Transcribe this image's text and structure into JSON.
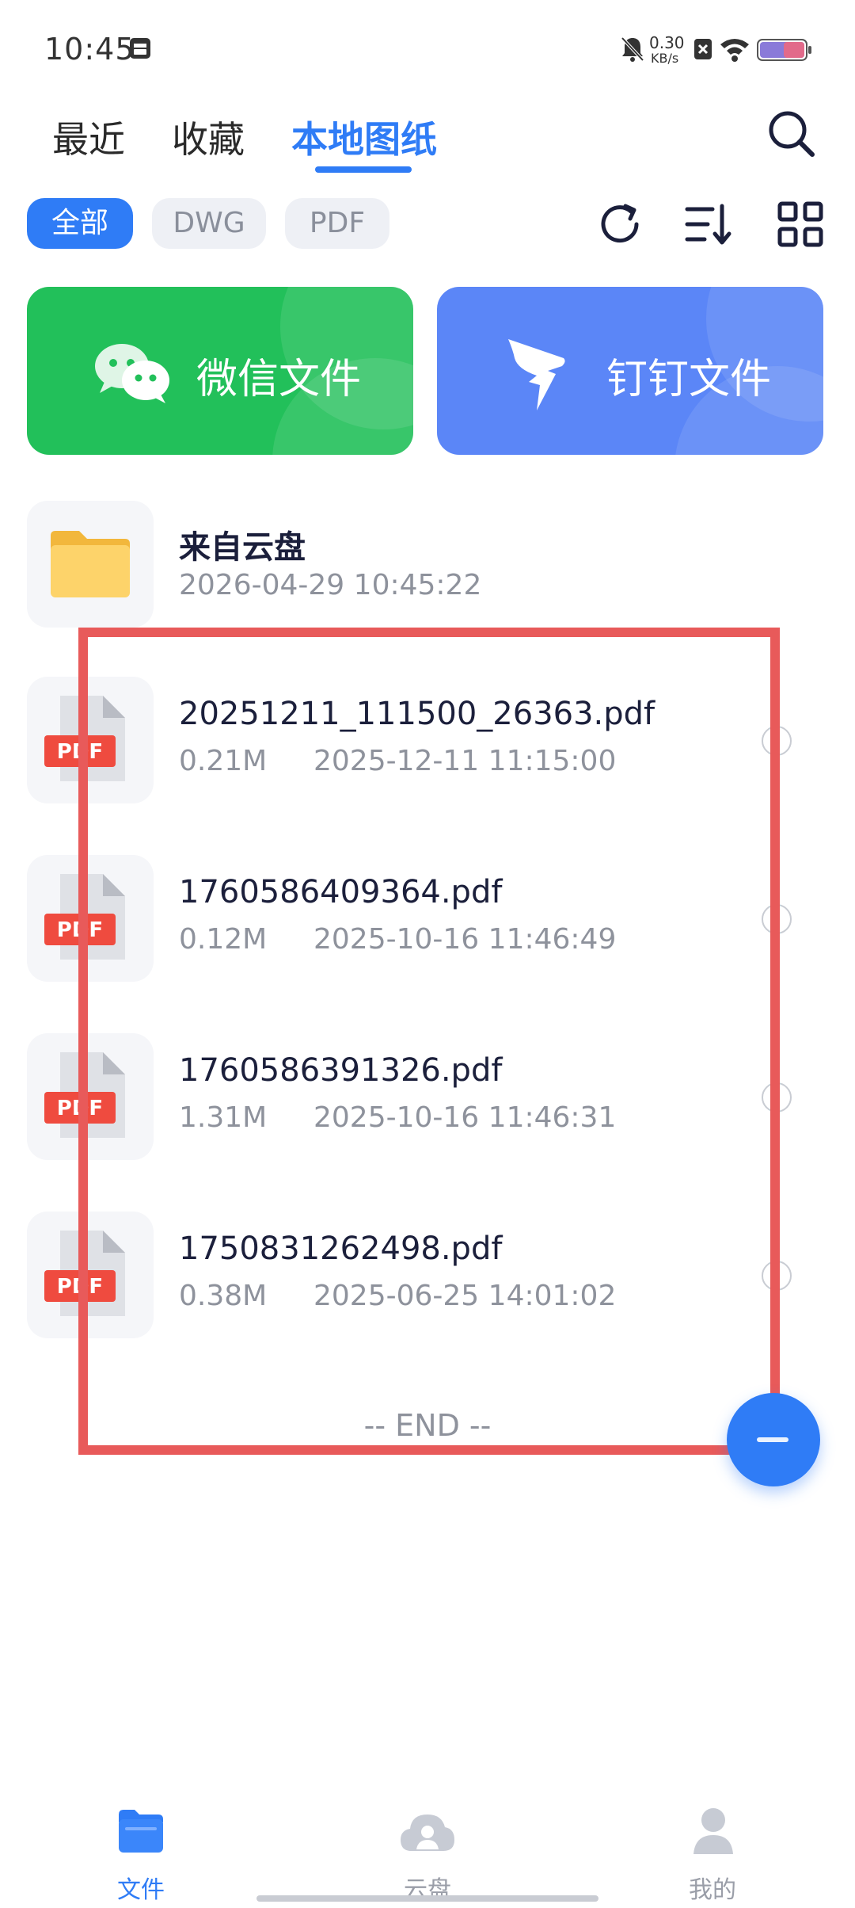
{
  "status_bar": {
    "time": "10:45",
    "net_speed_value": "0.30",
    "net_speed_unit": "KB/s"
  },
  "tabs": [
    {
      "label": "最近",
      "active": false
    },
    {
      "label": "收藏",
      "active": false
    },
    {
      "label": "本地图纸",
      "active": true
    }
  ],
  "filters": [
    {
      "label": "全部",
      "active": true
    },
    {
      "label": "DWG",
      "active": false
    },
    {
      "label": "PDF",
      "active": false
    }
  ],
  "cards": [
    {
      "label": "微信文件",
      "icon": "wechat-icon",
      "color": "#22c05a"
    },
    {
      "label": "钉钉文件",
      "icon": "dingtalk-icon",
      "color": "#5b86f7"
    }
  ],
  "folder": {
    "name": "来自云盘",
    "date": "2026-04-29 10:45:22"
  },
  "files": [
    {
      "name": "20251211_111500_26363.pdf",
      "size": "0.21M",
      "date": "2025-12-11 11:15:00",
      "type_badge": "PDF"
    },
    {
      "name": "1760586409364.pdf",
      "size": "0.12M",
      "date": "2025-10-16 11:46:49",
      "type_badge": "PDF"
    },
    {
      "name": "1760586391326.pdf",
      "size": "1.31M",
      "date": "2025-10-16 11:46:31",
      "type_badge": "PDF"
    },
    {
      "name": "1750831262498.pdf",
      "size": "0.38M",
      "date": "2025-06-25 14:01:02",
      "type_badge": "PDF"
    }
  ],
  "end_text": "-- END --",
  "bottom_nav": [
    {
      "label": "文件",
      "active": true
    },
    {
      "label": "云盘",
      "active": false
    },
    {
      "label": "我的",
      "active": false
    }
  ],
  "colors": {
    "accent": "#2f7cf6",
    "highlight": "#e85a5a",
    "pdf_badge": "#ef4b3f"
  }
}
